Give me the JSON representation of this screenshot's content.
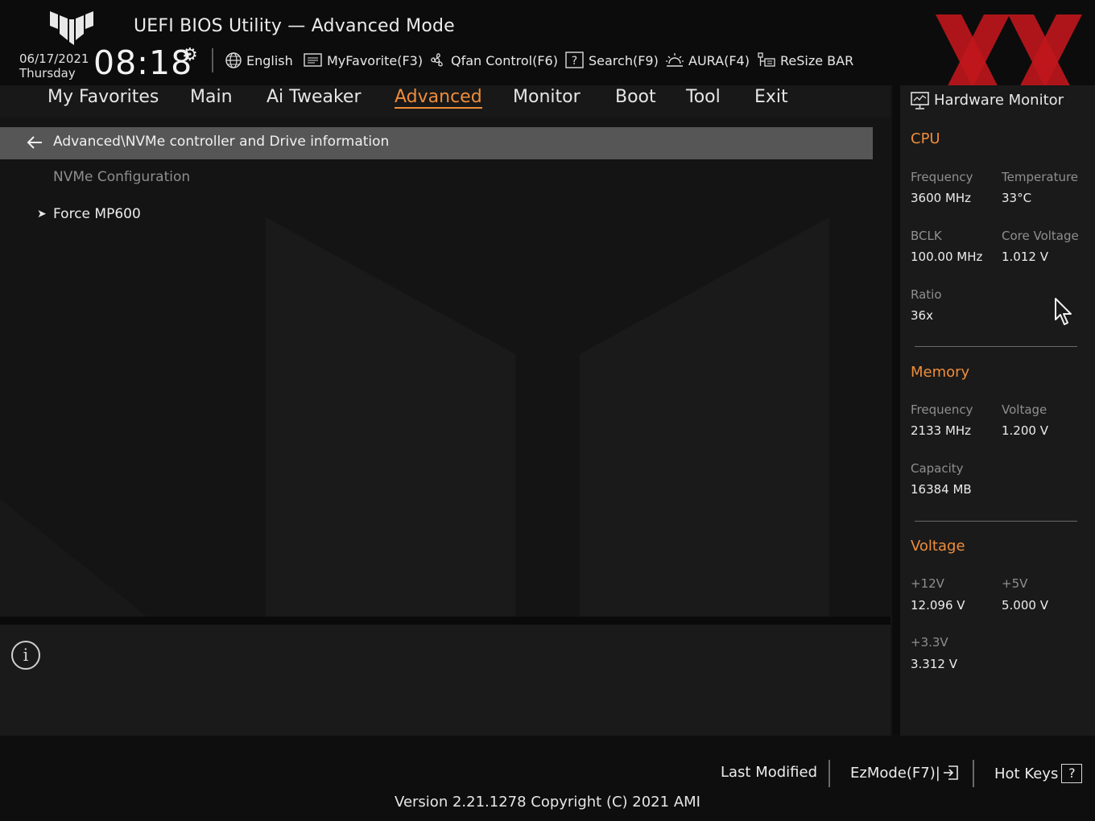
{
  "header": {
    "title": "UEFI BIOS Utility — Advanced Mode",
    "date": "06/17/2021",
    "weekday": "Thursday",
    "time": "08:18",
    "tools": [
      {
        "label": "English",
        "icon": "globe-icon"
      },
      {
        "label": "MyFavorite(F3)",
        "icon": "favorite-list-icon"
      },
      {
        "label": "Qfan Control(F6)",
        "icon": "fan-icon"
      },
      {
        "label": "Search(F9)",
        "icon": "help-search-icon"
      },
      {
        "label": "AURA(F4)",
        "icon": "aura-light-icon"
      },
      {
        "label": "ReSize BAR",
        "icon": "resize-bar-icon"
      }
    ]
  },
  "tabs": [
    {
      "label": "My Favorites"
    },
    {
      "label": "Main"
    },
    {
      "label": "Ai Tweaker"
    },
    {
      "label": "Advanced",
      "active": true
    },
    {
      "label": "Monitor"
    },
    {
      "label": "Boot"
    },
    {
      "label": "Tool"
    },
    {
      "label": "Exit"
    }
  ],
  "content": {
    "breadcrumb": "Advanced\\NVMe controller and Drive information",
    "section_label": "NVMe Configuration",
    "items": [
      {
        "label": "Force MP600"
      }
    ]
  },
  "hardware_monitor": {
    "title": "Hardware Monitor",
    "cpu": {
      "heading": "CPU",
      "frequency_label": "Frequency",
      "frequency": "3600 MHz",
      "temperature_label": "Temperature",
      "temperature": "33°C",
      "bclk_label": "BCLK",
      "bclk": "100.00 MHz",
      "core_voltage_label": "Core Voltage",
      "core_voltage": "1.012 V",
      "ratio_label": "Ratio",
      "ratio": "36x"
    },
    "memory": {
      "heading": "Memory",
      "frequency_label": "Frequency",
      "frequency": "2133 MHz",
      "voltage_label": "Voltage",
      "voltage": "1.200 V",
      "capacity_label": "Capacity",
      "capacity": "16384 MB"
    },
    "voltage": {
      "heading": "Voltage",
      "v12_label": "+12V",
      "v12": "12.096 V",
      "v5_label": "+5V",
      "v5": "5.000 V",
      "v33_label": "+3.3V",
      "v33": "3.312 V"
    }
  },
  "footer": {
    "last_modified": "Last Modified",
    "ezmode": "EzMode(F7)|",
    "hot_keys": "Hot Keys",
    "hot_keys_box": "?",
    "version": "Version 2.21.1278 Copyright (C) 2021 AMI"
  },
  "colors": {
    "accent": "#ee8d3a",
    "watermark": "#c0161c"
  }
}
